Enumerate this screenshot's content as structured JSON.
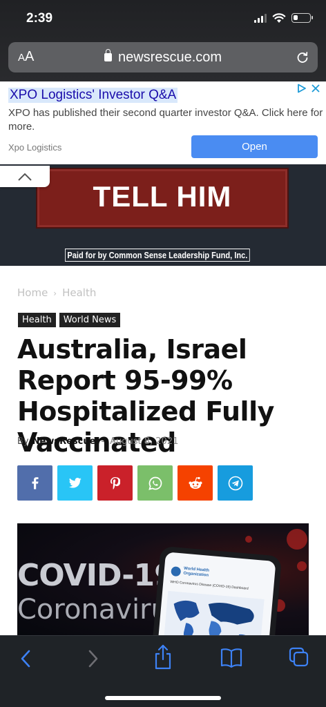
{
  "status_bar": {
    "time": "2:39",
    "signal_bars": 4,
    "signal_bars_active": 3,
    "battery_level": 0.25
  },
  "browser": {
    "aa_label_small": "A",
    "aa_label_large": "A",
    "url": "newsrescue.com"
  },
  "ad": {
    "title": "XPO Logistics' Investor Q&A",
    "description": "XPO has published their second quarter investor Q&A. Click here for more.",
    "source": "Xpo Logistics",
    "cta": "Open"
  },
  "banner": {
    "headline": "TELL HIM",
    "disclaimer": "Paid for by Common Sense Leadership Fund, Inc."
  },
  "article": {
    "breadcrumb": [
      "Home",
      "Health"
    ],
    "breadcrumb_sep": "›",
    "tags": [
      "Health",
      "World News"
    ],
    "title": "Australia, Israel Report 95-99% Hospitalized Fully Vaccinated",
    "byline_prefix": "By",
    "author": "NewsRescue",
    "byline_sep": "-",
    "date": "August 8, 2021",
    "share_buttons": [
      {
        "name": "facebook",
        "color": "#516eab",
        "icon": "f"
      },
      {
        "name": "twitter",
        "color": "#29c5f6",
        "icon": "twitter-bird"
      },
      {
        "name": "pinterest",
        "color": "#ca212a",
        "icon": "pinterest-p"
      },
      {
        "name": "whatsapp",
        "color": "#7bbf6a",
        "icon": "whatsapp-phone"
      },
      {
        "name": "reddit",
        "color": "#f54200",
        "icon": "reddit-alien"
      },
      {
        "name": "telegram",
        "color": "#179cde",
        "icon": "telegram-plane"
      }
    ],
    "hero_image": {
      "text_line1": "COVID-19",
      "text_line2": "Coronaviru",
      "phone_title_line1": "World Health",
      "phone_title_line2": "Organization",
      "phone_subtitle": "WHO Coronavirus Disease (COVID-19) Dashboard"
    }
  },
  "colors": {
    "ad_open_button": "#4a8cf2",
    "banner_red": "#7c1f1b",
    "toolbar_icon": "#3d82f6",
    "toolbar_icon_disabled": "#6e6e73"
  }
}
